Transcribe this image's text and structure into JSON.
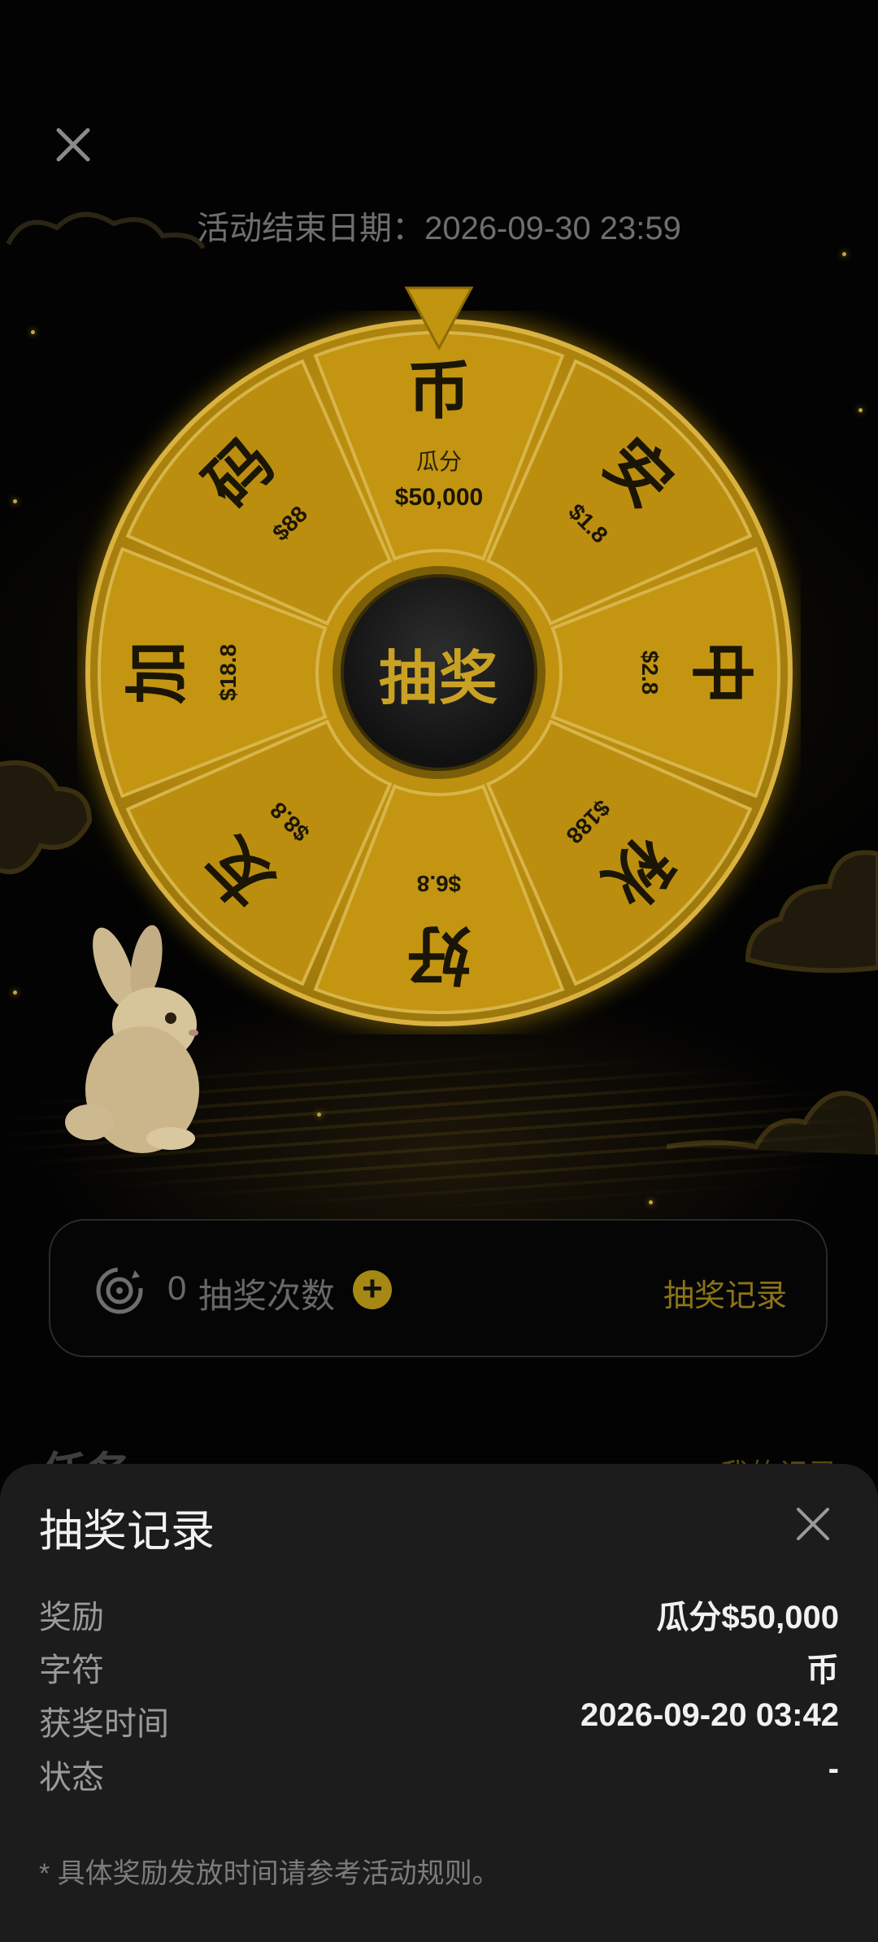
{
  "activity": {
    "end_date_label": "活动结束日期：2026-09-30 23:59"
  },
  "wheel": {
    "center_label": "抽奖",
    "segments": [
      {
        "char": "币",
        "sub": "瓜分",
        "amount": "$50,000"
      },
      {
        "char": "安",
        "amount": "$1.8"
      },
      {
        "char": "中",
        "amount": "$2.8"
      },
      {
        "char": "秋",
        "amount": "$188"
      },
      {
        "char": "好",
        "amount": "$6.8"
      },
      {
        "char": "友",
        "amount": "$8.8"
      },
      {
        "char": "加",
        "amount": "$18.8"
      },
      {
        "char": "码",
        "amount": "$88"
      }
    ]
  },
  "draws": {
    "count": "0",
    "label": "抽奖次数",
    "plus": "+",
    "record_link": "抽奖记录"
  },
  "tasks": {
    "title": "任务",
    "my_record": "我的记录"
  },
  "sheet": {
    "title": "抽奖记录",
    "rows": [
      {
        "key": "奖励",
        "value": "瓜分$50,000"
      },
      {
        "key": "字符",
        "value": "币"
      },
      {
        "key": "获奖时间",
        "value": "2026-09-20 03:42"
      },
      {
        "key": "状态",
        "value": "-"
      }
    ],
    "note": "* 具体奖励发放时间请参考活动规则。"
  },
  "colors": {
    "gold": "#d9a919",
    "gold_dark": "#8c7418",
    "sheet_bg": "#1c1c1c"
  }
}
